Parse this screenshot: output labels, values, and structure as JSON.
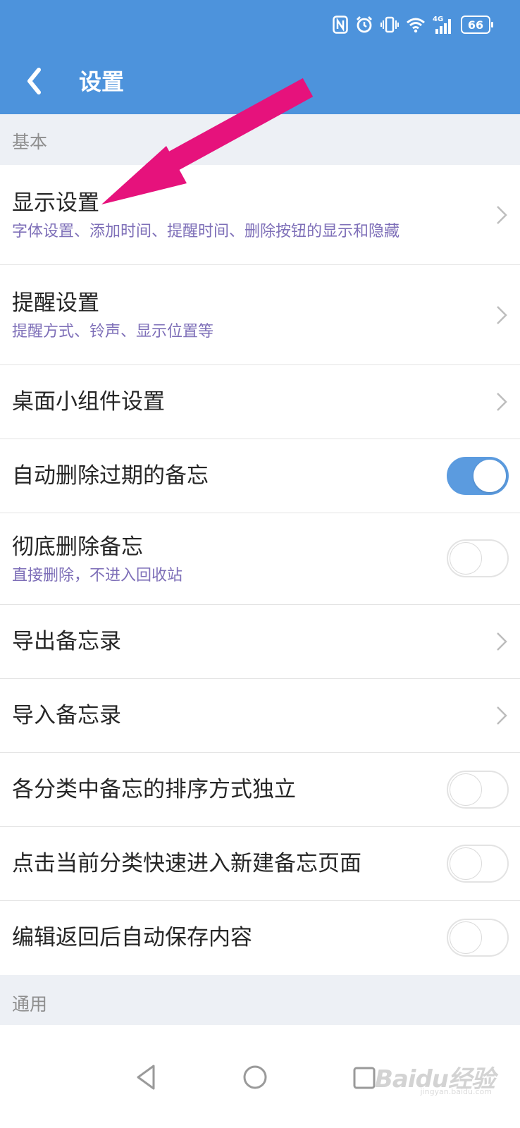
{
  "status_bar": {
    "icons": [
      "nfc-icon",
      "alarm-icon",
      "vibrate-icon",
      "wifi-icon",
      "signal-4g-icon"
    ],
    "network_label": "4G",
    "battery_level": "66"
  },
  "header": {
    "title": "设置",
    "back_icon": "chevron-left-icon"
  },
  "sections": {
    "basic": {
      "title": "基本"
    },
    "general": {
      "title": "通用"
    }
  },
  "rows": {
    "display": {
      "title": "显示设置",
      "subtitle": "字体设置、添加时间、提醒时间、删除按钮的显示和隐藏"
    },
    "reminder": {
      "title": "提醒设置",
      "subtitle": "提醒方式、铃声、显示位置等"
    },
    "widget": {
      "title": "桌面小组件设置"
    },
    "auto_delete": {
      "title": "自动删除过期的备忘",
      "toggle_on": true
    },
    "permanent_delete": {
      "title": "彻底删除备忘",
      "subtitle": "直接删除，不进入回收站",
      "toggle_on": false
    },
    "export": {
      "title": "导出备忘录"
    },
    "import": {
      "title": "导入备忘录"
    },
    "independent_sort": {
      "title": "各分类中备忘的排序方式独立",
      "toggle_on": false
    },
    "quick_new": {
      "title": "点击当前分类快速进入新建备忘页面",
      "toggle_on": false
    },
    "auto_save": {
      "title": "编辑返回后自动保存内容",
      "toggle_on": false
    }
  },
  "nav_bar": {
    "icons": [
      "back-triangle-icon",
      "home-circle-icon",
      "recents-square-icon"
    ]
  },
  "watermark": {
    "text": "Baidu经验",
    "url": "jingyan.baidu.com"
  },
  "annotation": {
    "icon": "pink-arrow-icon",
    "color": "#e6127c"
  },
  "colors": {
    "accent": "#4d93dc",
    "toggle_on": "#5b9bdf",
    "subtitle": "#7e6fb8"
  }
}
